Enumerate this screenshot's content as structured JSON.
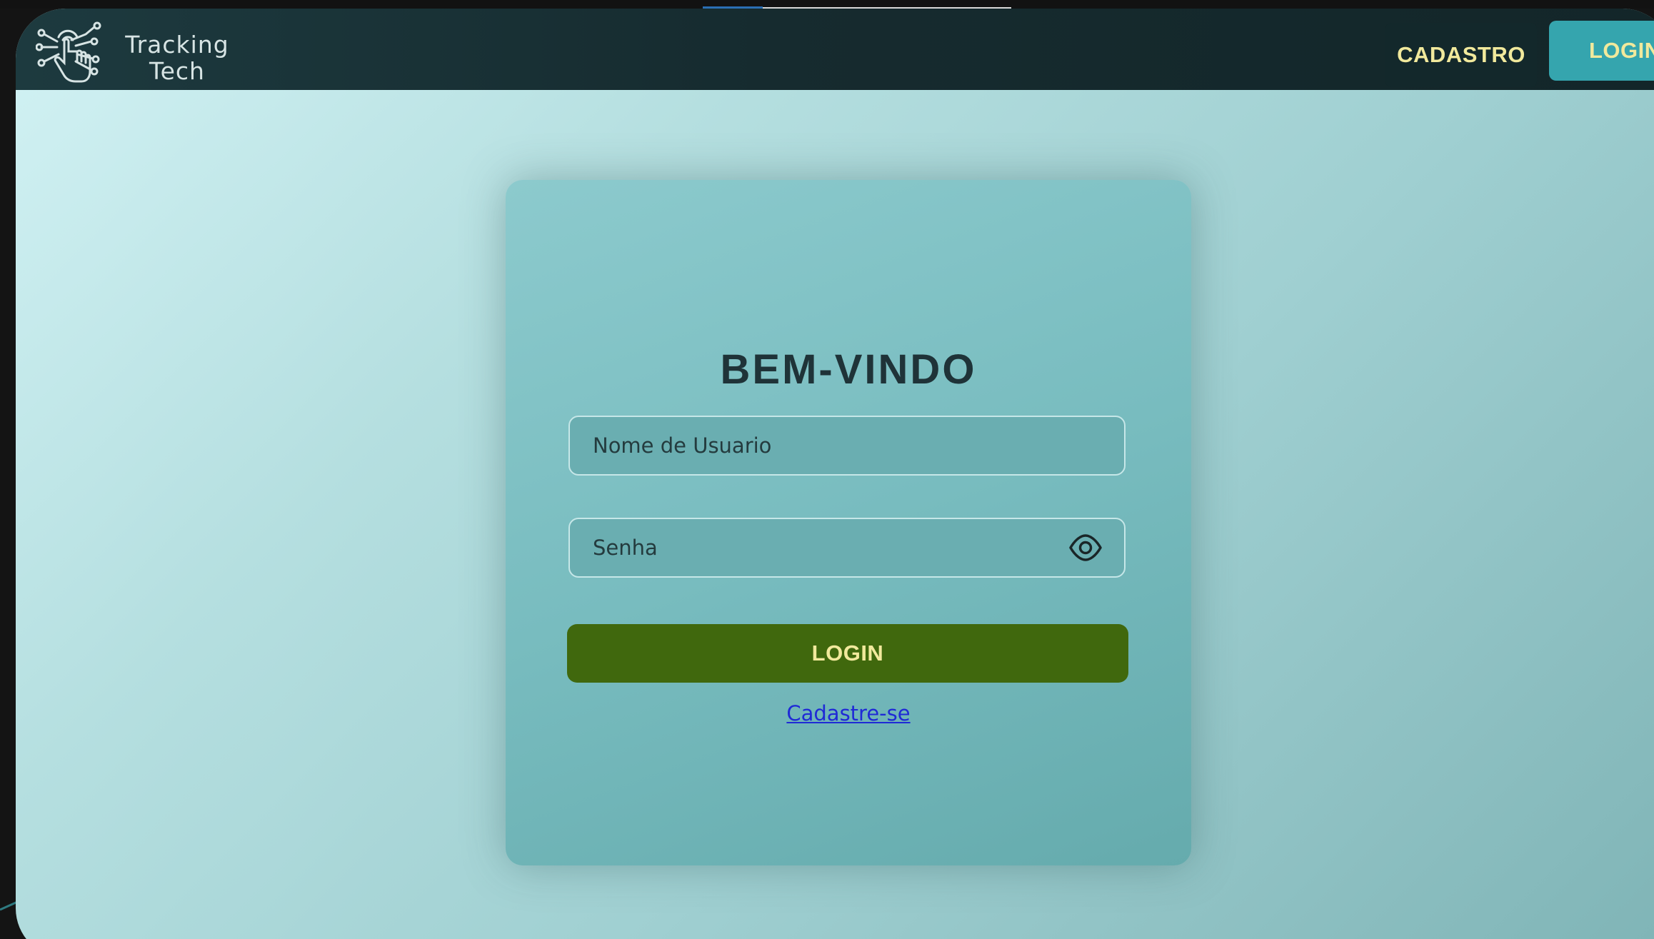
{
  "brand": {
    "line1": "Tracking",
    "line2": "Tech",
    "icon": "hand-circuit-logo-icon"
  },
  "nav": {
    "cadastro_label": "CADASTRO",
    "login_label": "LOGIN"
  },
  "login_form": {
    "title": "BEM-VINDO",
    "username_placeholder": "Nome de Usuario",
    "username_value": "",
    "password_placeholder": "Senha",
    "password_value": "",
    "password_toggle_icon": "eye-icon",
    "submit_label": "LOGIN",
    "signup_link": "Cadastre-se"
  },
  "colors": {
    "navbar": "#162b2f",
    "accent_teal": "#35a5ae",
    "login_button": "#40680d",
    "button_text": "#f1e99c",
    "link": "#1f2ad6"
  }
}
